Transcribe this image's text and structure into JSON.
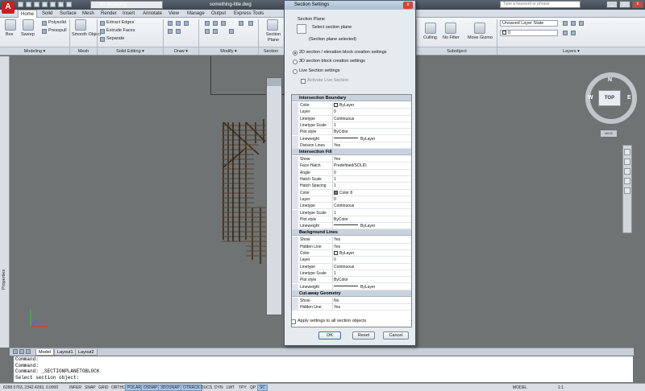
{
  "app": {
    "workspace": "3D Modeling",
    "doc_title": "something-title.dwg",
    "search_placeholder": "Type a keyword or phrase",
    "window_controls": [
      "_",
      "□",
      "x"
    ]
  },
  "ribbon_tabs": [
    "Home",
    "Solid",
    "Surface",
    "Mesh",
    "Render",
    "Insert",
    "Annotate",
    "View",
    "Manage",
    "Output",
    "Express Tools"
  ],
  "ribbon": {
    "modeling": {
      "box": "Box",
      "sweep": "Sweep",
      "polysolid": "Polysolid",
      "presspull": "Presspull"
    },
    "mesh": {
      "smooth_object": "Smooth Object"
    },
    "solid_editing": {
      "extract_edges": "Extract Edges",
      "extrude_faces": "Extrude Faces",
      "separate": "Separate"
    },
    "section": {
      "section_plane": "Section Plane"
    },
    "subobject": {
      "culling": "Culling",
      "no_filter": "No Filter",
      "move_gizmo": "Move Gizmo"
    },
    "layers": {
      "unsaved_layer_state": "Unsaved Layer State",
      "layer_zero": "0"
    },
    "panel_titles": [
      "Modeling ▾",
      "Mesh",
      "Solid Editing ▾",
      "Draw ▾",
      "Modify ▾",
      "Section",
      "Subobject",
      "Layers ▾"
    ]
  },
  "left_palette": {
    "label": "Properties"
  },
  "viewcube": {
    "top": "TOP",
    "n": "N",
    "w": "W",
    "e": "E",
    "wcs": "WCS"
  },
  "layout_tabs": [
    "Model",
    "Layout1",
    "Layout2"
  ],
  "command_lines": [
    "Command:",
    "Command:",
    "Command: _SECTIONPLANETOBLOCK",
    "Select section object:"
  ],
  "status": {
    "coords": "6288.5763, 2342.4293, 0.0000",
    "toggles": [
      "INFER",
      "SNAP",
      "GRID",
      "ORTHO",
      "POLAR",
      "OSNAP",
      "3DOSNAP",
      "OTRACK",
      "DUCS",
      "DYN",
      "LWT",
      "TPY",
      "QP",
      "SC"
    ],
    "toggles_on": [
      "POLAR",
      "OSNAP",
      "3DOSNAP",
      "OTRACK",
      "SC"
    ],
    "model": "MODEL",
    "scale": "1:1"
  },
  "dialog": {
    "title": "Section Settings",
    "section_plane_label": "Section Plane",
    "select_section_plane": "Select section plane",
    "section_plane_status": "(Section plane selected)",
    "opt_2d": "2D section / elevation block creation settings",
    "opt_3d": "3D section block creation settings",
    "opt_live": "Live Section settings",
    "activate_live": "Activate Live Section",
    "apply_all": "Apply settings to all section objects",
    "ok": "OK",
    "reset": "Reset",
    "cancel": "Cancel",
    "grid": [
      {
        "category": "Intersection Boundary",
        "rows": [
          {
            "k": "Color",
            "v": "ByLayer",
            "swatch": "#ffffff"
          },
          {
            "k": "Layer",
            "v": "0"
          },
          {
            "k": "Linetype",
            "v": "Continuous"
          },
          {
            "k": "Linetype Scale",
            "v": "1"
          },
          {
            "k": "Plot style",
            "v": "ByColor"
          },
          {
            "k": "Lineweight",
            "v": "ByLayer",
            "line": true
          },
          {
            "k": "Division Lines",
            "v": "Yes"
          }
        ]
      },
      {
        "category": "Intersection Fill",
        "rows": [
          {
            "k": "Show",
            "v": "Yes"
          },
          {
            "k": "Face Hatch",
            "v": "Predefined/SOLID"
          },
          {
            "k": "Angle",
            "v": "0"
          },
          {
            "k": "Hatch Scale",
            "v": "1"
          },
          {
            "k": "Hatch Spacing",
            "v": "1"
          },
          {
            "k": "Color",
            "v": "Color 8",
            "swatch": "#808080"
          },
          {
            "k": "Layer",
            "v": "0"
          },
          {
            "k": "Linetype",
            "v": "Continuous"
          },
          {
            "k": "Linetype Scale",
            "v": "1"
          },
          {
            "k": "Plot style",
            "v": "ByColor"
          },
          {
            "k": "Lineweight",
            "v": "ByLayer",
            "line": true
          }
        ]
      },
      {
        "category": "Background Lines",
        "rows": [
          {
            "k": "Show",
            "v": "Yes"
          },
          {
            "k": "Hidden Line",
            "v": "Yes"
          },
          {
            "k": "Color",
            "v": "ByLayer",
            "swatch": "#ffffff"
          },
          {
            "k": "Layer",
            "v": "0"
          },
          {
            "k": "Linetype",
            "v": "Continuous"
          },
          {
            "k": "Linetype Scale",
            "v": "1"
          },
          {
            "k": "Plot style",
            "v": "ByColor"
          },
          {
            "k": "Lineweight",
            "v": "ByLayer",
            "line": true
          }
        ]
      },
      {
        "category": "Cut-away Geometry",
        "rows": [
          {
            "k": "Show",
            "v": "No"
          },
          {
            "k": "Hidden Line",
            "v": "Yes"
          }
        ]
      }
    ]
  }
}
